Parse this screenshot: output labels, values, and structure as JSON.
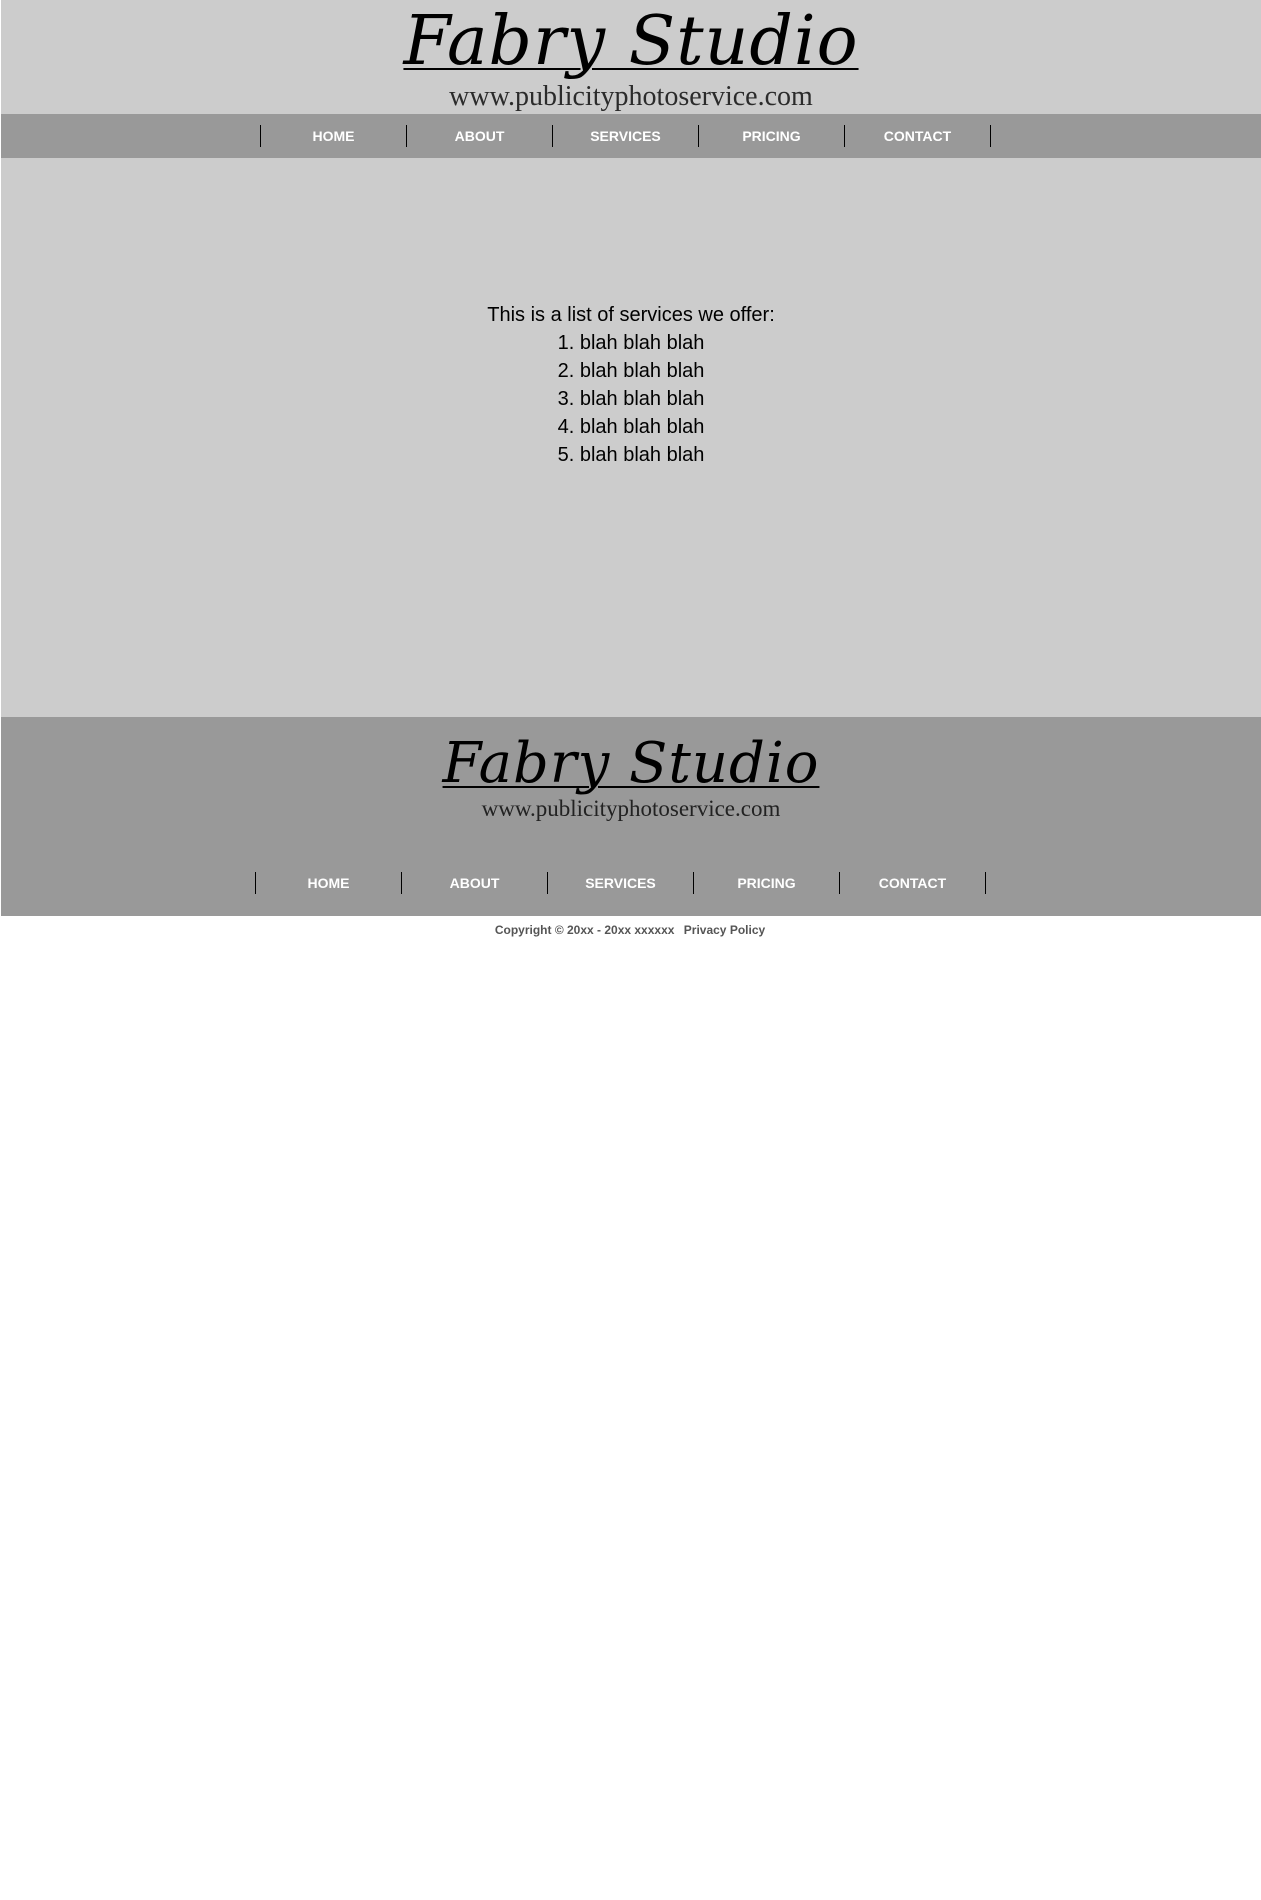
{
  "header": {
    "logo_title": "Fabry Studio",
    "logo_url": "www.publicityphotoservice.com"
  },
  "nav": {
    "items": [
      {
        "label": "HOME"
      },
      {
        "label": "ABOUT"
      },
      {
        "label": "SERVICES"
      },
      {
        "label": "PRICING"
      },
      {
        "label": "CONTACT"
      }
    ]
  },
  "main": {
    "intro": "This is a list of services we offer:",
    "services": [
      "1. blah blah blah",
      "2. blah blah blah",
      "3. blah blah blah",
      "4. blah blah blah",
      "5. blah blah blah"
    ]
  },
  "footer": {
    "logo_title": "Fabry Studio",
    "logo_url": "www.publicityphotoservice.com",
    "copyright": "Copyright © 20xx - 20xx xxxxxx",
    "privacy_label": "Privacy Policy"
  },
  "colors": {
    "header_bg": "#cccccc",
    "nav_bg": "#999999",
    "nav_text": "#ffffff",
    "footer_bg": "#999999",
    "page_bg": "#ffffff"
  }
}
